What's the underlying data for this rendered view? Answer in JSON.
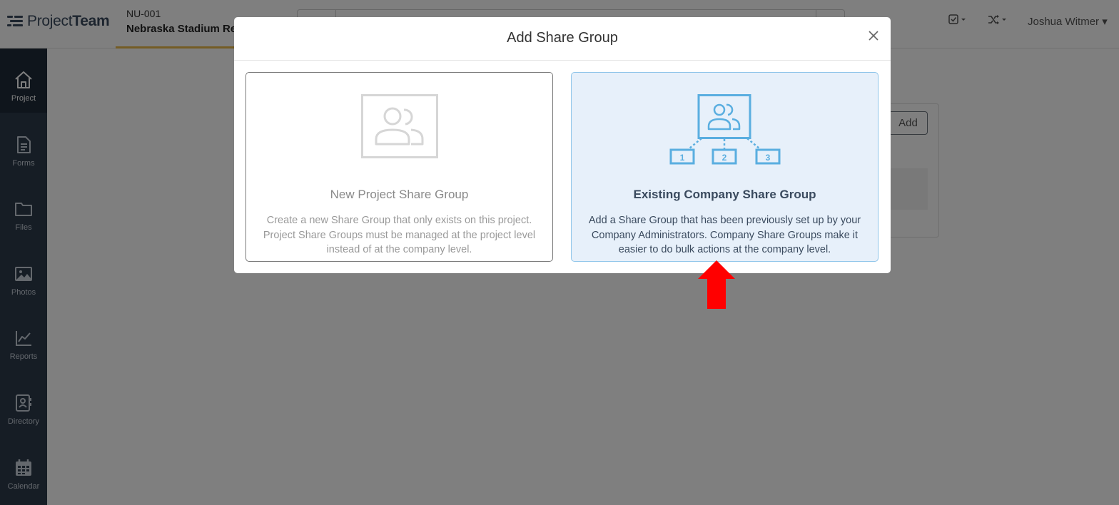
{
  "app": {
    "logo_prefix": "Project",
    "logo_suffix": "Team"
  },
  "project": {
    "code": "NU-001",
    "name": "Nebraska Stadium Re"
  },
  "header": {
    "user_name": "Joshua Witmer ▾",
    "tasks_icon": "checkbox-icon",
    "switch_icon": "shuffle-icon"
  },
  "sidebar": {
    "items": [
      {
        "label": "Project",
        "icon": "home-icon"
      },
      {
        "label": "Forms",
        "icon": "document-icon"
      },
      {
        "label": "Files",
        "icon": "folder-icon"
      },
      {
        "label": "Photos",
        "icon": "image-icon"
      },
      {
        "label": "Reports",
        "icon": "chart-icon"
      },
      {
        "label": "Directory",
        "icon": "contact-icon"
      },
      {
        "label": "Calendar",
        "icon": "calendar-icon"
      }
    ]
  },
  "background": {
    "add_label": "Add"
  },
  "modal": {
    "title": "Add Share Group",
    "options": [
      {
        "title": "New Project Share Group",
        "description": "Create a new Share Group that only exists on this project. Project Share Groups must be managed at the project level instead of at the company level."
      },
      {
        "title": "Existing Company Share Group",
        "description": "Add a Share Group that has been previously set up by your Company Administrators. Company Share Groups make it easier to do bulk actions at the company level.",
        "tiers": [
          "1",
          "2",
          "3"
        ]
      }
    ]
  },
  "colors": {
    "accent": "#5aaee0",
    "sidebar": "#2c3a4b",
    "highlight_arrow": "#ff0000",
    "tab_underline": "#e9b949"
  }
}
